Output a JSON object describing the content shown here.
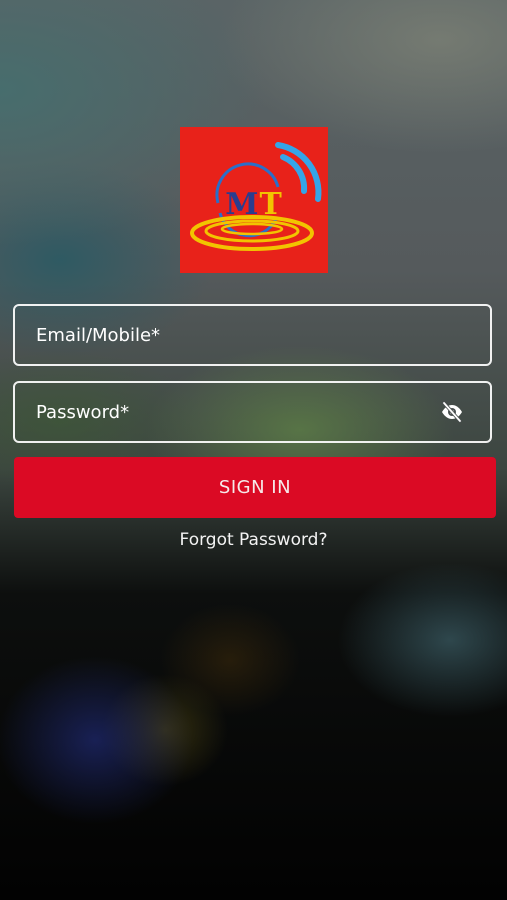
{
  "logo": {
    "text_m": "M",
    "text_t": "T",
    "background": "#e8221a",
    "ring_color": "#f2c400",
    "signal_color": "#35a5e8",
    "arc_color": "#2a6fc9"
  },
  "form": {
    "email_placeholder": "Email/Mobile*",
    "password_placeholder": "Password*",
    "password_toggle_icon": "eye-off-icon",
    "sign_in_label": "SIGN IN",
    "forgot_password_label": "Forgot Password?"
  },
  "colors": {
    "primary_button": "#db0a24",
    "field_border": "#ffffff",
    "text": "#ffffff"
  }
}
